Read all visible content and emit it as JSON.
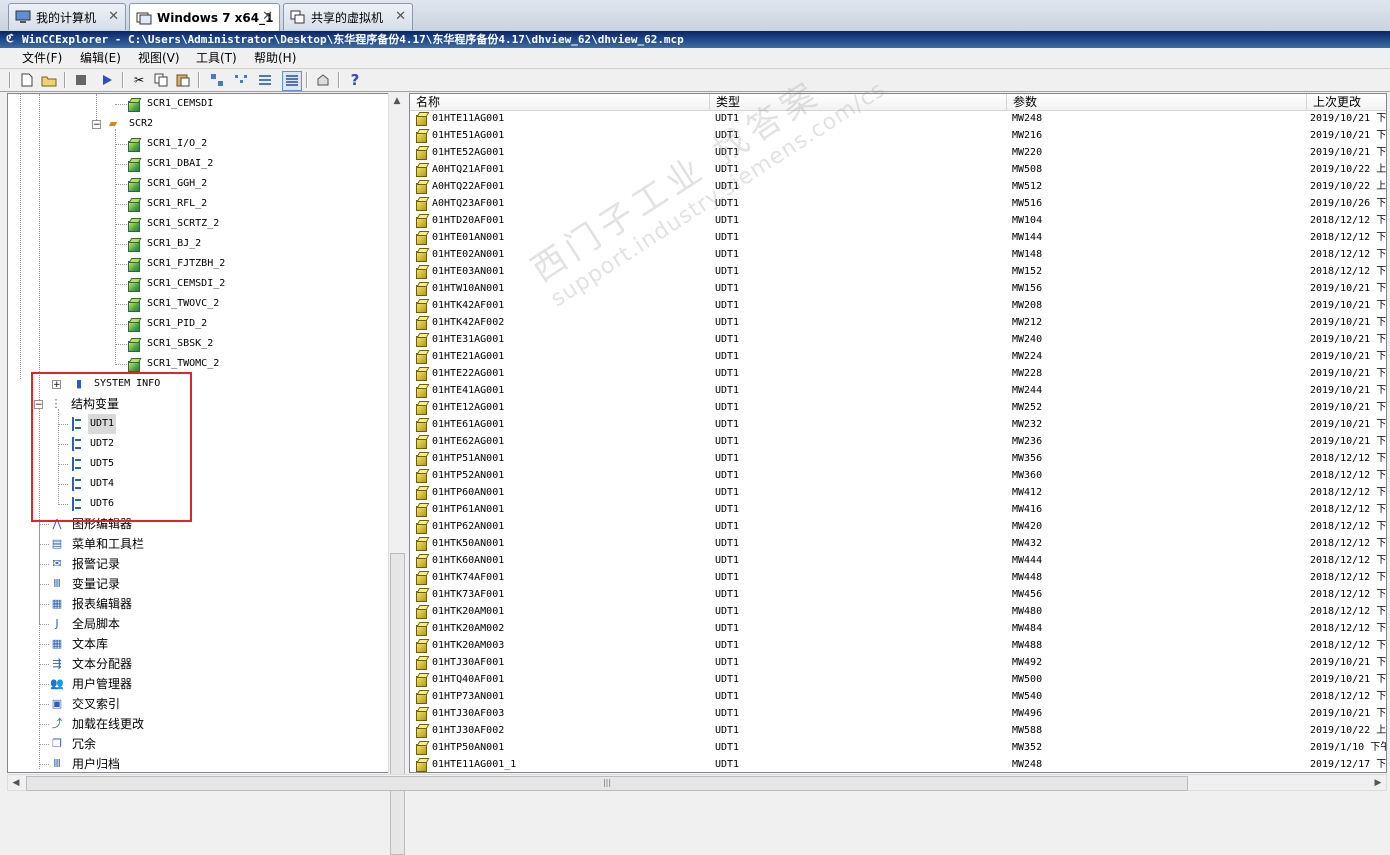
{
  "vm_tabs": [
    {
      "label": "我的计算机",
      "active": false,
      "icon": "computer-icon"
    },
    {
      "label": "Windows 7 x64_1",
      "active": true,
      "icon": "vm-icon"
    },
    {
      "label": "共享的虚拟机",
      "active": false,
      "icon": "shared-vm-icon"
    }
  ],
  "window": {
    "title": "WinCCExplorer - C:\\Users\\Administrator\\Desktop\\东华程序备份4.17\\东华程序备份4.17\\dhview_62\\dhview_62.mcp"
  },
  "menu": [
    "文件(F)",
    "编辑(E)",
    "视图(V)",
    "工具(T)",
    "帮助(H)"
  ],
  "toolbar": [
    "new-icon",
    "open-icon",
    "stop-icon",
    "run-icon",
    "cut-icon",
    "copy-icon",
    "paste-icon",
    "large-icons-icon",
    "small-icons-icon",
    "list-icon",
    "details-icon",
    "properties-icon",
    "help-icon"
  ],
  "tree": {
    "top_item": "SCR1_CEMSDI",
    "scr2": "SCR2",
    "scr2_children": [
      "SCR1_I/O_2",
      "SCR1_DBAI_2",
      "SCR1_GGH_2",
      "SCR1_RFL_2",
      "SCR1_SCRTZ_2",
      "SCR1_BJ_2",
      "SCR1_FJTZBH_2",
      "SCR1_CEMSDI_2",
      "SCR1_TWOVC_2",
      "SCR1_PID_2",
      "SCR1_SBSK_2",
      "SCR1_TWOMC_2"
    ],
    "system_info": "SYSTEM INFO",
    "struct_vars": "结构变量",
    "udts": [
      "UDT1",
      "UDT2",
      "UDT5",
      "UDT4",
      "UDT6"
    ],
    "editors": [
      {
        "label": "图形编辑器",
        "icon": "graphics-designer-icon"
      },
      {
        "label": "菜单和工具栏",
        "icon": "menus-toolbars-icon"
      },
      {
        "label": "报警记录",
        "icon": "alarm-logging-icon"
      },
      {
        "label": "变量记录",
        "icon": "tag-logging-icon"
      },
      {
        "label": "报表编辑器",
        "icon": "report-designer-icon"
      },
      {
        "label": "全局脚本",
        "icon": "global-script-icon"
      },
      {
        "label": "文本库",
        "icon": "text-library-icon"
      },
      {
        "label": "文本分配器",
        "icon": "text-distributor-icon"
      },
      {
        "label": "用户管理器",
        "icon": "user-administrator-icon"
      },
      {
        "label": "交叉索引",
        "icon": "cross-reference-icon"
      },
      {
        "label": "加载在线更改",
        "icon": "load-online-changes-icon"
      },
      {
        "label": "冗余",
        "icon": "redundancy-icon"
      },
      {
        "label": "用户归档",
        "icon": "user-archive-icon"
      }
    ]
  },
  "list": {
    "columns": [
      "名称",
      "类型",
      "参数",
      "上次更改"
    ],
    "rows": [
      [
        "01HTE11AG001",
        "UDT1",
        "MW248",
        "2019/10/21 下"
      ],
      [
        "01HTE51AG001",
        "UDT1",
        "MW216",
        "2019/10/21 下"
      ],
      [
        "01HTE52AG001",
        "UDT1",
        "MW220",
        "2019/10/21 下"
      ],
      [
        "A0HTQ21AF001",
        "UDT1",
        "MW508",
        "2019/10/22 上"
      ],
      [
        "A0HTQ22AF001",
        "UDT1",
        "MW512",
        "2019/10/22 上"
      ],
      [
        "A0HTQ23AF001",
        "UDT1",
        "MW516",
        "2019/10/26 下"
      ],
      [
        "01HTD20AF001",
        "UDT1",
        "MW104",
        "2018/12/12 下"
      ],
      [
        "01HTE01AN001",
        "UDT1",
        "MW144",
        "2018/12/12 下"
      ],
      [
        "01HTE02AN001",
        "UDT1",
        "MW148",
        "2018/12/12 下"
      ],
      [
        "01HTE03AN001",
        "UDT1",
        "MW152",
        "2018/12/12 下"
      ],
      [
        "01HTW10AN001",
        "UDT1",
        "MW156",
        "2019/10/21 下"
      ],
      [
        "01HTK42AF001",
        "UDT1",
        "MW208",
        "2019/10/21 下"
      ],
      [
        "01HTK42AF002",
        "UDT1",
        "MW212",
        "2019/10/21 下"
      ],
      [
        "01HTE31AG001",
        "UDT1",
        "MW240",
        "2019/10/21 下"
      ],
      [
        "01HTE21AG001",
        "UDT1",
        "MW224",
        "2019/10/21 下"
      ],
      [
        "01HTE22AG001",
        "UDT1",
        "MW228",
        "2019/10/21 下"
      ],
      [
        "01HTE41AG001",
        "UDT1",
        "MW244",
        "2019/10/21 下"
      ],
      [
        "01HTE12AG001",
        "UDT1",
        "MW252",
        "2019/10/21 下"
      ],
      [
        "01HTE61AG001",
        "UDT1",
        "MW232",
        "2019/10/21 下"
      ],
      [
        "01HTE62AG001",
        "UDT1",
        "MW236",
        "2019/10/21 下"
      ],
      [
        "01HTP51AN001",
        "UDT1",
        "MW356",
        "2018/12/12 下"
      ],
      [
        "01HTP52AN001",
        "UDT1",
        "MW360",
        "2018/12/12 下"
      ],
      [
        "01HTP60AN001",
        "UDT1",
        "MW412",
        "2018/12/12 下"
      ],
      [
        "01HTP61AN001",
        "UDT1",
        "MW416",
        "2018/12/12 下"
      ],
      [
        "01HTP62AN001",
        "UDT1",
        "MW420",
        "2018/12/12 下"
      ],
      [
        "01HTK50AN001",
        "UDT1",
        "MW432",
        "2018/12/12 下"
      ],
      [
        "01HTK60AN001",
        "UDT1",
        "MW444",
        "2018/12/12 下"
      ],
      [
        "01HTK74AF001",
        "UDT1",
        "MW448",
        "2018/12/12 下"
      ],
      [
        "01HTK73AF001",
        "UDT1",
        "MW456",
        "2018/12/12 下"
      ],
      [
        "01HTK20AM001",
        "UDT1",
        "MW480",
        "2018/12/12 下"
      ],
      [
        "01HTK20AM002",
        "UDT1",
        "MW484",
        "2018/12/12 下"
      ],
      [
        "01HTK20AM003",
        "UDT1",
        "MW488",
        "2018/12/12 下"
      ],
      [
        "01HTJ30AF001",
        "UDT1",
        "MW492",
        "2019/10/21 下"
      ],
      [
        "01HTQ40AF001",
        "UDT1",
        "MW500",
        "2019/10/21 下"
      ],
      [
        "01HTP73AN001",
        "UDT1",
        "MW540",
        "2018/12/12 下"
      ],
      [
        "01HTJ30AF003",
        "UDT1",
        "MW496",
        "2019/10/21 下"
      ],
      [
        "01HTJ30AF002",
        "UDT1",
        "MW588",
        "2019/10/22 上"
      ],
      [
        "01HTP50AN001",
        "UDT1",
        "MW352",
        "2019/1/10 下午"
      ],
      [
        "01HTE11AG001_1",
        "UDT1",
        "MW248",
        "2019/12/17 下"
      ]
    ]
  },
  "watermark": {
    "line1": "西门子工业 找答案",
    "line2": "support.industry.siemens.com/cs"
  },
  "colors": {
    "titlebar": "#0a246a",
    "highlight_box": "#e0242a"
  }
}
